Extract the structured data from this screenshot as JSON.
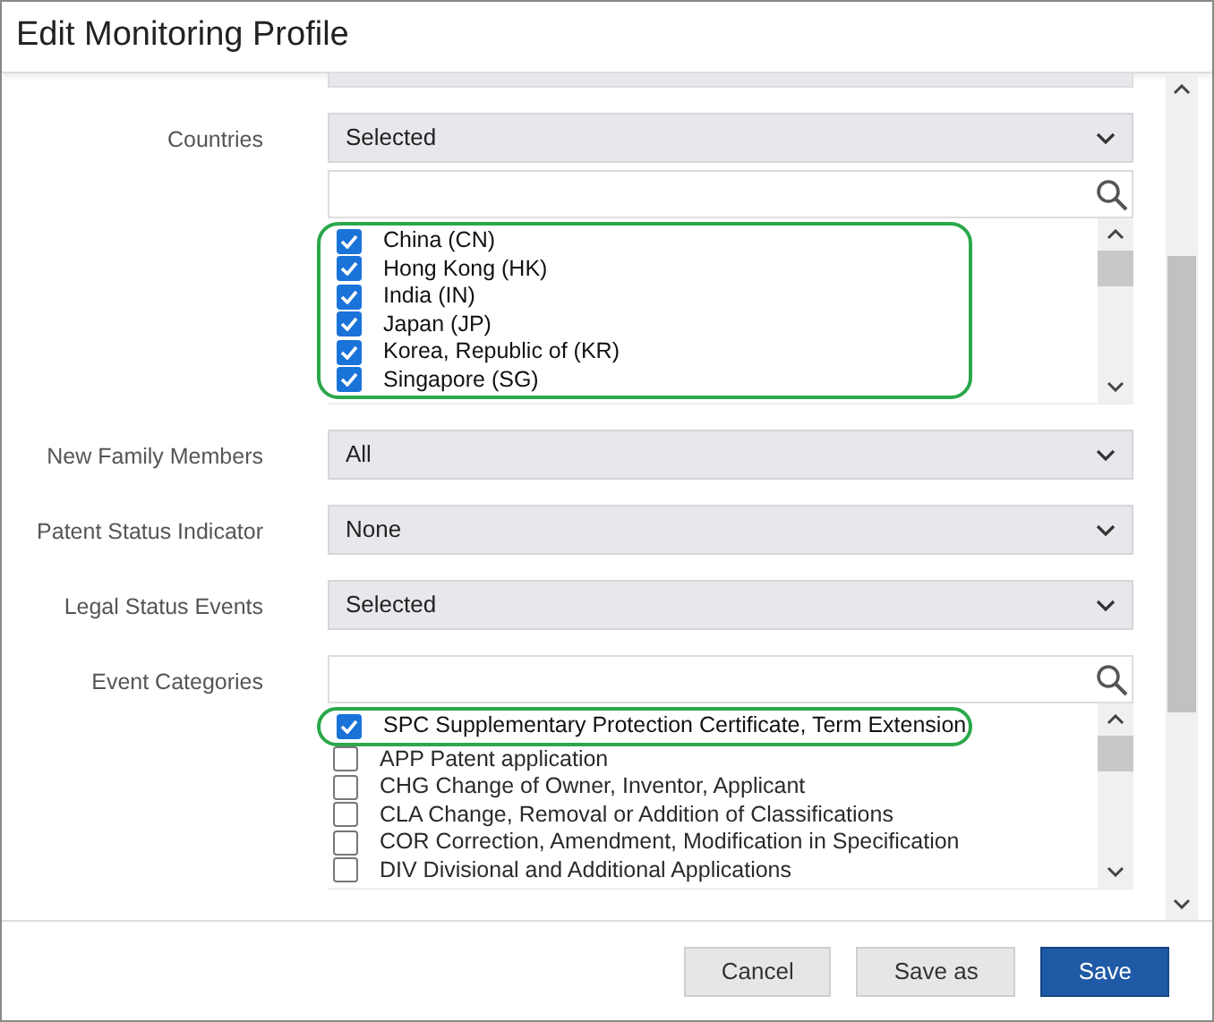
{
  "dialog": {
    "title": "Edit Monitoring Profile"
  },
  "fields": [
    {
      "kind": "select",
      "label": "Countries",
      "value": "Selected"
    },
    {
      "kind": "checklist",
      "items": [
        {
          "label": "China (CN)",
          "checked": true,
          "highlighted": true
        },
        {
          "label": "Hong Kong (HK)",
          "checked": true,
          "highlighted": true
        },
        {
          "label": "India (IN)",
          "checked": true,
          "highlighted": true
        },
        {
          "label": "Japan (JP)",
          "checked": true,
          "highlighted": true
        },
        {
          "label": "Korea, Republic of (KR)",
          "checked": true,
          "highlighted": true
        },
        {
          "label": "Singapore (SG)",
          "checked": true,
          "highlighted": true
        }
      ]
    },
    {
      "kind": "select",
      "label": "New Family Members",
      "value": "All"
    },
    {
      "kind": "select",
      "label": "Patent Status Indicator",
      "value": "None"
    },
    {
      "kind": "select",
      "label": "Legal Status Events",
      "value": "Selected"
    },
    {
      "kind": "checklist",
      "label": "Event Categories",
      "items": [
        {
          "label": "SPC Supplementary Protection Certificate, Term Extension",
          "checked": true,
          "highlighted": true
        },
        {
          "label": "APP Patent application",
          "checked": false,
          "highlighted": false
        },
        {
          "label": "CHG Change of Owner, Inventor, Applicant",
          "checked": false,
          "highlighted": false
        },
        {
          "label": "CLA Change, Removal or Addition of Classifications",
          "checked": false,
          "highlighted": false
        },
        {
          "label": "COR Correction, Amendment, Modification in Specification",
          "checked": false,
          "highlighted": false
        },
        {
          "label": "DIV Divisional and Additional Applications",
          "checked": false,
          "highlighted": false
        }
      ]
    }
  ],
  "buttons": [
    {
      "label": "Cancel",
      "kind": "secondary"
    },
    {
      "label": "Save as",
      "kind": "secondary"
    },
    {
      "label": "Save",
      "kind": "primary"
    }
  ]
}
